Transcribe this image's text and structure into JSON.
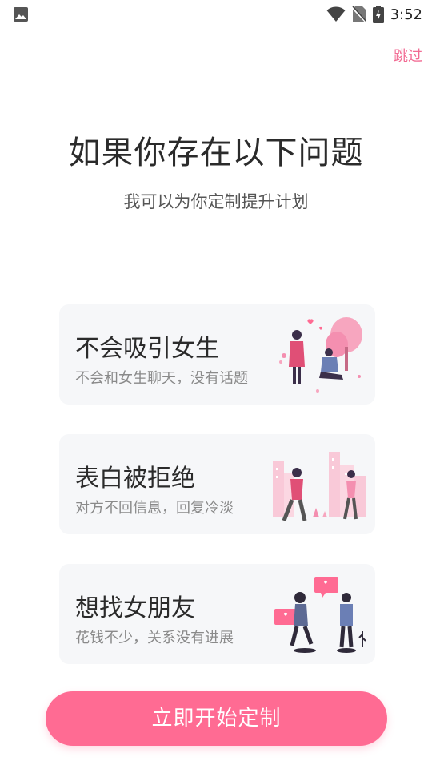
{
  "status_bar": {
    "time": "3:52",
    "icons": [
      "image-icon",
      "wifi-icon",
      "no-sim-icon",
      "battery-charging-icon"
    ]
  },
  "header": {
    "skip_label": "跳过",
    "title": "如果你存在以下问题",
    "subtitle": "我可以为你定制提升计划"
  },
  "cards": [
    {
      "title": "不会吸引女生",
      "desc": "不会和女生聊天，没有话题"
    },
    {
      "title": "表白被拒绝",
      "desc": "对方不回信息，回复冷淡"
    },
    {
      "title": "想找女朋友",
      "desc": "花钱不少，关系没有进展"
    }
  ],
  "cta": {
    "label": "立即开始定制"
  },
  "colors": {
    "accent": "#ff6b93",
    "skip": "#f26c94",
    "card_bg": "#f6f7f9"
  }
}
